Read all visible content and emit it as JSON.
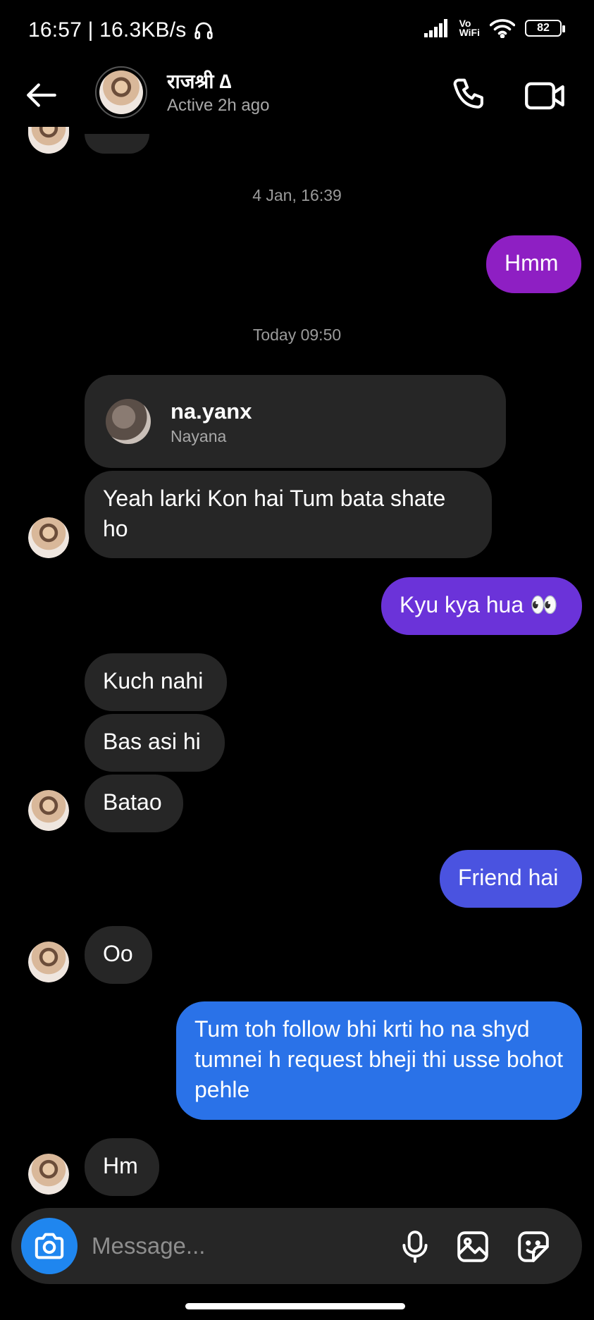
{
  "status_bar": {
    "time_speed": "16:57 | 16.3KB/s",
    "vowifi_top": "Vo",
    "vowifi_bottom": "WiFi",
    "battery": "82"
  },
  "header": {
    "name": "राजश्री ∆",
    "status": "Active 2h ago",
    "icons": [
      "back-arrow-icon",
      "phone-icon",
      "video-camera-icon"
    ]
  },
  "chat": {
    "timestamps": [
      "4 Jan, 16:39",
      "Today 09:50"
    ],
    "shared_profile": {
      "username": "na.yanx",
      "display_name": "Nayana"
    },
    "messages": [
      {
        "from": "me",
        "text": "Hmm"
      },
      {
        "from": "them",
        "text": "Yeah larki Kon hai Tum bata shate ho"
      },
      {
        "from": "me",
        "text": "Kyu kya hua 👀"
      },
      {
        "from": "them",
        "text": "Kuch nahi"
      },
      {
        "from": "them",
        "text": "Bas asi hi"
      },
      {
        "from": "them",
        "text": "Batao"
      },
      {
        "from": "me",
        "text": "Friend hai"
      },
      {
        "from": "them",
        "text": "Oo"
      },
      {
        "from": "me",
        "text": "Tum toh follow bhi krti ho na shyd tumnei h request bheji thi usse bohot pehle"
      },
      {
        "from": "them",
        "text": "Hm"
      }
    ]
  },
  "composer": {
    "placeholder": "Message...",
    "icons": [
      "camera-icon",
      "microphone-icon",
      "gallery-icon",
      "sticker-icon"
    ]
  },
  "colors": {
    "background": "#000000",
    "incoming_bubble": "#262626",
    "outgoing_purple": "#8e1fc3",
    "outgoing_violet": "#6b33d9",
    "outgoing_indigo": "#4a53e0",
    "outgoing_blue": "#2a72e8",
    "camera_button": "#1f86ef"
  }
}
